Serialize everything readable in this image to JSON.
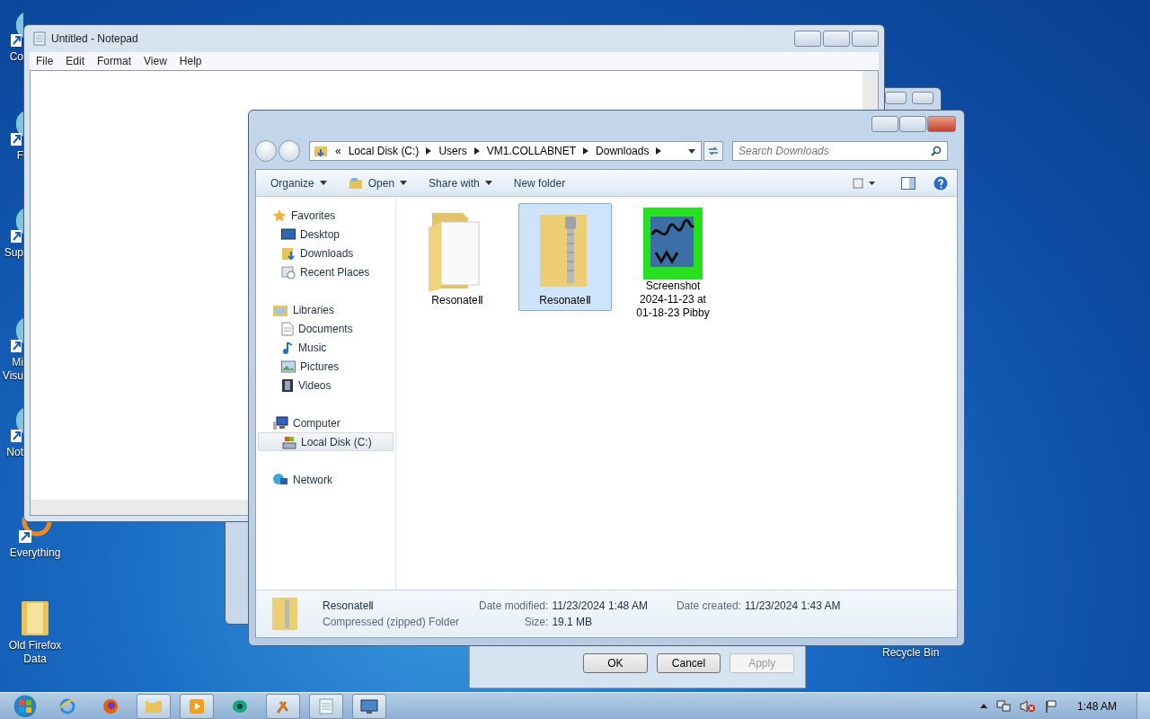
{
  "desktop": {
    "icons": [
      {
        "kind": "app",
        "lines": [
          "Co"
        ]
      },
      {
        "kind": "app",
        "lines": [
          "F"
        ]
      },
      {
        "kind": "app",
        "lines": [
          "Sup"
        ]
      },
      {
        "kind": "app",
        "lines": [
          "Mi",
          "Visu"
        ]
      },
      {
        "kind": "app",
        "lines": [
          "Not"
        ]
      },
      {
        "kind": "shortcut",
        "lines": [
          "Everything"
        ]
      },
      {
        "kind": "folder",
        "lines": [
          "Old Firefox",
          "Data"
        ]
      }
    ],
    "recycle_bin": {
      "label": "Recycle Bin"
    }
  },
  "notepad": {
    "title": "Untitled - Notepad",
    "menu": [
      "File",
      "Edit",
      "Format",
      "View",
      "Help"
    ]
  },
  "properties_dialog": {
    "buttons": [
      {
        "label": "OK",
        "disabled": false
      },
      {
        "label": "Cancel",
        "disabled": false
      },
      {
        "label": "Apply",
        "disabled": true
      }
    ]
  },
  "explorer": {
    "overflow": "«",
    "breadcrumb": [
      "Local Disk (C:)",
      "Users",
      "VM1.COLLABNET",
      "Downloads"
    ],
    "search": {
      "placeholder": "Search Downloads"
    },
    "toolbar": [
      {
        "label": "Organize",
        "dropdown": true,
        "icon": false
      },
      {
        "label": "Open",
        "dropdown": true,
        "icon": true
      },
      {
        "label": "Share with",
        "dropdown": true,
        "icon": false
      },
      {
        "label": "New folder",
        "dropdown": false,
        "icon": false
      }
    ],
    "nav": [
      {
        "label": "Favorites",
        "kind": "star",
        "selected": false,
        "children": [
          {
            "label": "Desktop",
            "kind": "desktop",
            "selected": false
          },
          {
            "label": "Downloads",
            "kind": "downloads",
            "selected": false
          },
          {
            "label": "Recent Places",
            "kind": "recent",
            "selected": false
          }
        ]
      },
      {
        "label": "Libraries",
        "kind": "libraries",
        "selected": false,
        "children": [
          {
            "label": "Documents",
            "kind": "document",
            "selected": false
          },
          {
            "label": "Music",
            "kind": "music",
            "selected": false
          },
          {
            "label": "Pictures",
            "kind": "pictures",
            "selected": false
          },
          {
            "label": "Videos",
            "kind": "videos",
            "selected": false
          }
        ]
      },
      {
        "label": "Computer",
        "kind": "computer",
        "selected": false,
        "children": [
          {
            "label": "Local Disk (C:)",
            "kind": "disk",
            "selected": true
          }
        ]
      },
      {
        "label": "Network",
        "kind": "network",
        "selected": false
      }
    ],
    "files": [
      {
        "name": "ResonateⅡ",
        "kind": "folder",
        "selected": false
      },
      {
        "name": "ResonateⅡ",
        "kind": "zip",
        "selected": true
      },
      {
        "name": "Screenshot 2024-11-23 at 01-18-23 Pibby",
        "kind": "image",
        "selected": false
      }
    ],
    "details": {
      "name": "ResonateⅡ",
      "type": "Compressed (zipped) Folder",
      "fields": [
        {
          "label": "Date modified:",
          "value": "11/23/2024 1:48 AM"
        },
        {
          "label": "Date created:",
          "value": "11/23/2024 1:43 AM"
        },
        {
          "label": "Size:",
          "value": "19.1 MB"
        }
      ]
    }
  },
  "taskbar": {
    "apps": [
      {
        "kind": "ie",
        "open": false
      },
      {
        "kind": "firefox",
        "open": false
      },
      {
        "kind": "explorer",
        "open": true
      },
      {
        "kind": "media",
        "open": true
      },
      {
        "kind": "globe",
        "open": false
      },
      {
        "kind": "tools",
        "open": true
      },
      {
        "kind": "notepad",
        "open": true
      },
      {
        "kind": "monitor",
        "open": true
      }
    ],
    "clock": "1:48 AM"
  }
}
